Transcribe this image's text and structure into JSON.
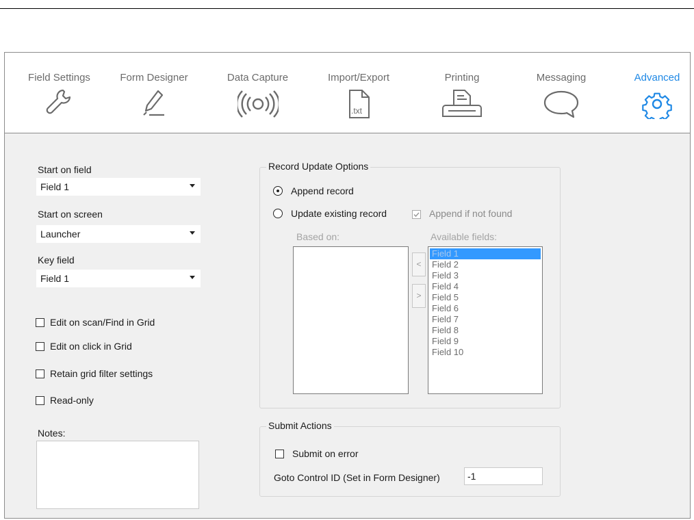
{
  "tabs": [
    {
      "label": "Field Settings",
      "icon": "wrench-icon",
      "active": false
    },
    {
      "label": "Form Designer",
      "icon": "pencil-icon",
      "active": false
    },
    {
      "label": "Data Capture",
      "icon": "rfid-signal-icon",
      "active": false
    },
    {
      "label": "Import/Export",
      "icon": "txt-file-icon",
      "active": false
    },
    {
      "label": "Printing",
      "icon": "printer-icon",
      "active": false
    },
    {
      "label": "Messaging",
      "icon": "speech-bubble-icon",
      "active": false
    },
    {
      "label": "Advanced",
      "icon": "gear-icon",
      "active": true
    }
  ],
  "txt_icon_text": ".txt",
  "left": {
    "start_on_field": {
      "label": "Start on field",
      "value": "Field 1"
    },
    "start_on_screen": {
      "label": "Start on screen",
      "value": "Launcher"
    },
    "key_field": {
      "label": "Key field",
      "value": "Field 1"
    },
    "checkboxes": [
      {
        "label": "Edit on scan/Find in Grid",
        "checked": false
      },
      {
        "label": "Edit on click in Grid",
        "checked": false
      },
      {
        "label": "Retain grid filter settings",
        "checked": false
      },
      {
        "label": "Read-only",
        "checked": false
      }
    ],
    "notes_label": "Notes:",
    "notes_value": ""
  },
  "record_update": {
    "title": "Record Update Options",
    "append_record": "Append record",
    "update_existing": "Update existing record",
    "selected": "append",
    "append_if_not_found": "Append if not found",
    "append_if_not_found_checked": true,
    "based_on_label": "Based on:",
    "available_fields_label": "Available fields:",
    "move_left": "<",
    "move_right": ">",
    "available_fields": [
      "Field 1",
      "Field 2",
      "Field 3",
      "Field 4",
      "Field 5",
      "Field 6",
      "Field 7",
      "Field 8",
      "Field 9",
      "Field 10"
    ],
    "selected_field": "Field 1"
  },
  "submit_actions": {
    "title": "Submit Actions",
    "submit_on_error": "Submit on error",
    "submit_on_error_checked": false,
    "goto_label": "Goto Control ID (Set in Form Designer)",
    "goto_value": "-1"
  },
  "colors": {
    "accent": "#1e88e5",
    "tab_text": "#6b6b6b",
    "selection": "#3399ff"
  }
}
